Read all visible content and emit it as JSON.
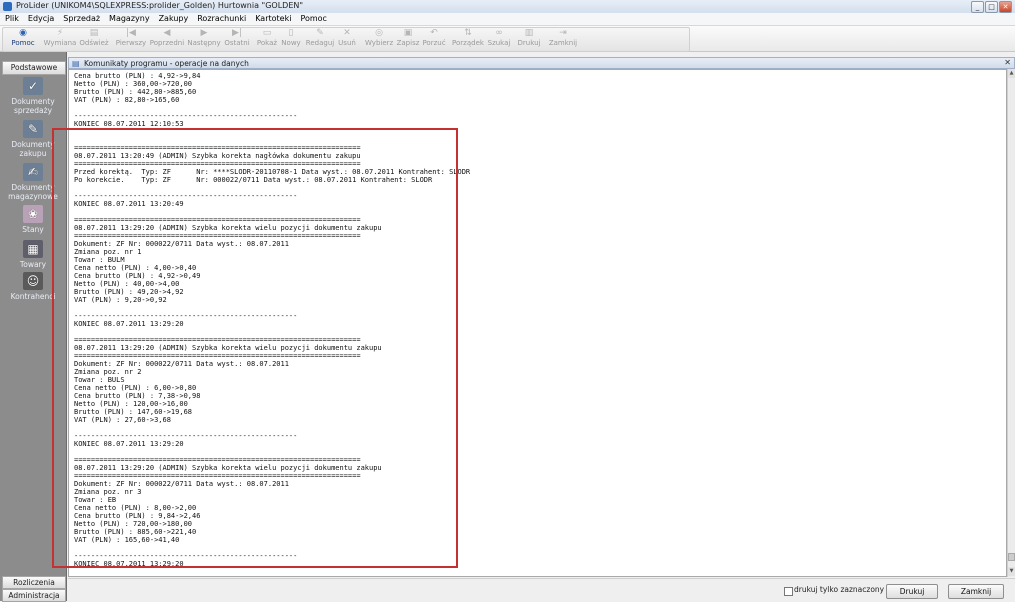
{
  "window": {
    "title": "ProLider  (UNIKOM4\\SQLEXPRESS:prolider_Golden) Hurtownia \"GOLDEN\""
  },
  "menu": [
    "Plik",
    "Edycja",
    "Sprzedaż",
    "Magazyny",
    "Zakupy",
    "Rozrachunki",
    "Kartoteki",
    "Pomoc"
  ],
  "toolbar": {
    "pomoc": "Pomoc",
    "wymiana": "Wymiana",
    "odswiez": "Odśwież",
    "pierwszy": "Pierwszy",
    "poprzedni": "Poprzedni",
    "nastepny": "Następny",
    "ostatni": "Ostatni",
    "pokaz": "Pokaż",
    "nowy": "Nowy",
    "redaguj": "Redaguj",
    "usun": "Usuń",
    "wybierz": "Wybierz",
    "zapisz": "Zapisz",
    "porzuc": "Porzuć",
    "porzadek": "Porządek",
    "szukaj": "Szukaj",
    "drukuj": "Drukuj",
    "zamknij": "Zamknij"
  },
  "sidebar": {
    "header": "Podstawowe",
    "items": [
      {
        "label": "Dokumenty sprzedaży",
        "icon": "sales-documents-icon"
      },
      {
        "label": "Dokumenty zakupu",
        "icon": "purchase-documents-icon"
      },
      {
        "label": "Dokumenty magazynowe",
        "icon": "warehouse-documents-icon"
      },
      {
        "label": "Stany",
        "icon": "stock-icon"
      },
      {
        "label": "Towary",
        "icon": "goods-icon"
      },
      {
        "label": "Kontrahenci",
        "icon": "contractors-icon"
      }
    ],
    "footer1": "Rozliczenia",
    "footer2": "Administracja"
  },
  "subwindow": {
    "title": "Komunikaty programu - operacje na danych"
  },
  "log": [
    "Cena brutto (PLN) : 4,92->9,84",
    "Netto (PLN) : 360,00->720,00",
    "Brutto (PLN) : 442,80->885,60",
    "VAT (PLN) : 82,80->165,60",
    "",
    "-----------------------------------------------------",
    "KONIEC 08.07.2011 12:10:53",
    "",
    "",
    "====================================================================",
    "08.07.2011 13:20:49 (ADMIN) Szybka korekta nagłówka dokumentu zakupu",
    "====================================================================",
    "Przed korektą.  Typ: ZF      Nr: ****SLODR-20110708-1 Data wyst.: 08.07.2011 Kontrahent: SLODR",
    "Po korekcie.    Typ: ZF      Nr: 000022/0711 Data wyst.: 08.07.2011 Kontrahent: SLODR",
    "",
    "-----------------------------------------------------",
    "KONIEC 08.07.2011 13:20:49",
    "",
    "====================================================================",
    "08.07.2011 13:29:20 (ADMIN) Szybka korekta wielu pozycji dokumentu zakupu",
    "====================================================================",
    "Dokument: ZF Nr: 000022/0711 Data wyst.: 08.07.2011",
    "Zmiana poz. nr 1",
    "Towar : BULM",
    "Cena netto (PLN) : 4,00->0,40",
    "Cena brutto (PLN) : 4,92->0,49",
    "Netto (PLN) : 40,00->4,00",
    "Brutto (PLN) : 49,20->4,92",
    "VAT (PLN) : 9,20->0,92",
    "",
    "-----------------------------------------------------",
    "KONIEC 08.07.2011 13:29:20",
    "",
    "====================================================================",
    "08.07.2011 13:29:20 (ADMIN) Szybka korekta wielu pozycji dokumentu zakupu",
    "====================================================================",
    "Dokument: ZF Nr: 000022/0711 Data wyst.: 08.07.2011",
    "Zmiana poz. nr 2",
    "Towar : BULS",
    "Cena netto (PLN) : 6,00->0,80",
    "Cena brutto (PLN) : 7,38->0,98",
    "Netto (PLN) : 120,00->16,00",
    "Brutto (PLN) : 147,60->19,68",
    "VAT (PLN) : 27,60->3,68",
    "",
    "-----------------------------------------------------",
    "KONIEC 08.07.2011 13:29:20",
    "",
    "====================================================================",
    "08.07.2011 13:29:20 (ADMIN) Szybka korekta wielu pozycji dokumentu zakupu",
    "====================================================================",
    "Dokument: ZF Nr: 000022/0711 Data wyst.: 08.07.2011",
    "Zmiana poz. nr 3",
    "Towar : EB",
    "Cena netto (PLN) : 8,00->2,00",
    "Cena brutto (PLN) : 9,84->2,46",
    "Netto (PLN) : 720,00->180,00",
    "Brutto (PLN) : 885,60->221,40",
    "VAT (PLN) : 165,60->41,40",
    "",
    "-----------------------------------------------------",
    "KONIEC 08.07.2011 13:29:20"
  ],
  "bottom": {
    "checkbox_label": "drukuj tylko zaznaczony tekst",
    "print_button": "Drukuj",
    "close_button": "Zamknij"
  }
}
